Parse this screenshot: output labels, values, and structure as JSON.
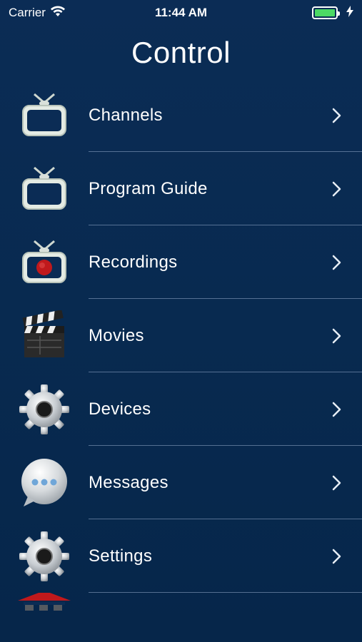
{
  "status_bar": {
    "carrier": "Carrier",
    "time": "11:44 AM",
    "battery_level": 1.0,
    "battery_color": "#4cd964"
  },
  "nav": {
    "title": "Control"
  },
  "menu": {
    "items": [
      {
        "label": "Channels",
        "icon": "tv-icon"
      },
      {
        "label": "Program Guide",
        "icon": "tv-icon"
      },
      {
        "label": "Recordings",
        "icon": "tv-record-icon"
      },
      {
        "label": "Movies",
        "icon": "clapperboard-icon"
      },
      {
        "label": "Devices",
        "icon": "gear-icon"
      },
      {
        "label": "Messages",
        "icon": "speech-bubble-icon"
      },
      {
        "label": "Settings",
        "icon": "gear-icon"
      },
      {
        "label": "",
        "icon": "house-icon"
      }
    ]
  },
  "colors": {
    "background": "#0a2a52",
    "separator": "#b4c8e6",
    "accent_red": "#c0191c"
  }
}
